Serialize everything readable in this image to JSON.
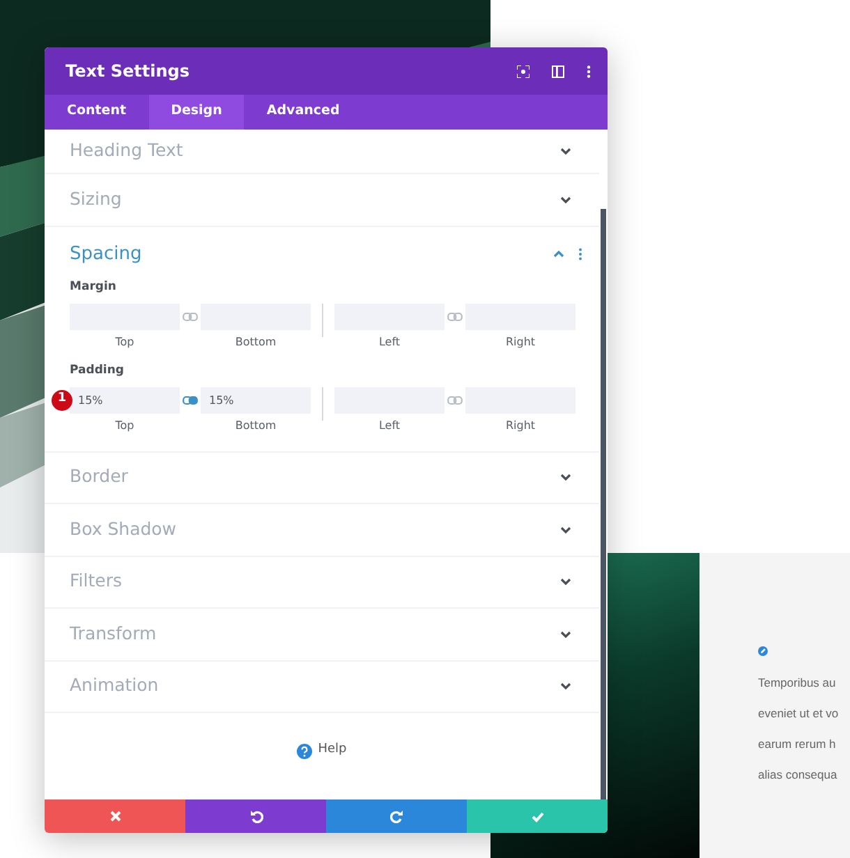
{
  "modal": {
    "title": "Text Settings",
    "tabs": [
      {
        "label": "Content",
        "selected": false
      },
      {
        "label": "Design",
        "selected": true
      },
      {
        "label": "Advanced",
        "selected": false
      }
    ],
    "sections": [
      {
        "title": "Heading Text",
        "expanded": false
      },
      {
        "title": "Sizing",
        "expanded": false
      },
      {
        "title": "Spacing",
        "expanded": true,
        "groups": [
          {
            "label": "Margin",
            "fields": [
              {
                "label": "Top"
              },
              {
                "label": "Bottom"
              },
              {
                "label": "Left"
              },
              {
                "label": "Right"
              }
            ],
            "links": [
              {
                "linked": false
              },
              {
                "linked": false
              }
            ]
          },
          {
            "label": "Padding",
            "badge": "1",
            "fields": [
              {
                "value": "15%",
                "label": "Top"
              },
              {
                "value": "15%",
                "label": "Bottom"
              },
              {
                "label": "Left"
              },
              {
                "label": "Right"
              }
            ],
            "links": [
              {
                "linked": true
              },
              {
                "linked": false
              }
            ]
          }
        ]
      },
      {
        "title": "Border",
        "expanded": false
      },
      {
        "title": "Box Shadow",
        "expanded": false
      },
      {
        "title": "Filters",
        "expanded": false
      },
      {
        "title": "Transform",
        "expanded": false
      },
      {
        "title": "Animation",
        "expanded": false
      }
    ],
    "help": "Help",
    "footer": [
      {
        "kind": "cancel"
      },
      {
        "kind": "undo"
      },
      {
        "kind": "redo"
      },
      {
        "kind": "save"
      }
    ]
  },
  "page_text": [
    "Temporibus au",
    "eveniet ut et vo",
    "earum rerum h",
    "alias consequa"
  ]
}
